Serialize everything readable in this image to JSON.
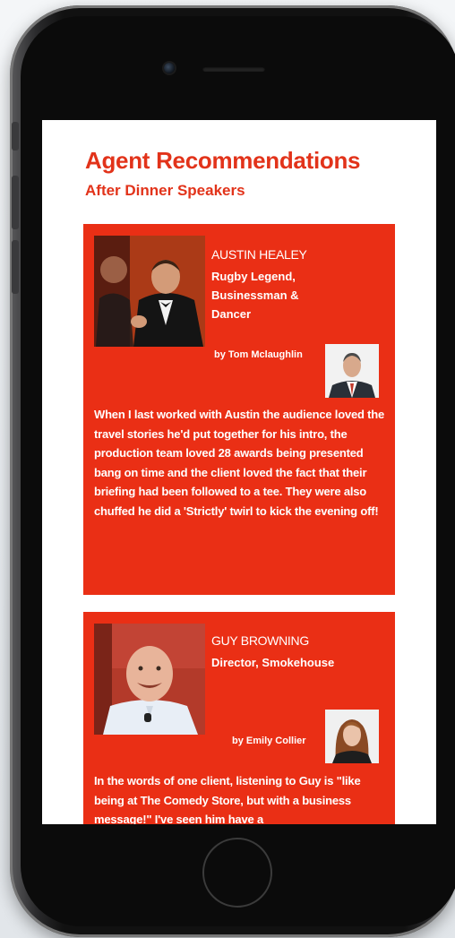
{
  "page": {
    "title": "Agent Recommendations",
    "subtitle": "After Dinner Speakers"
  },
  "recommendations": [
    {
      "name": "AUSTIN HEALEY",
      "role": "Rugby Legend, Businessman & Dancer",
      "by": "by Tom Mclaughlin",
      "quote": "When I last worked with Austin the audience loved the travel stories he'd put together for his intro, the production team loved 28 awards being presented bang on time and the client loved the fact that their briefing had been followed to a tee. They were also chuffed he did a 'Strictly' twirl to kick the evening off!",
      "speaker_photo": "speaker-photo-tuxedo",
      "agent_photo": "agent-photo-man"
    },
    {
      "name": "GUY BROWNING",
      "role": "Director, Smokehouse",
      "by": "by Emily Collier",
      "quote": "In the words of one client, listening to Guy is \"like being at The Comedy Store, but with a business message!\" I've seen him have a",
      "speaker_photo": "speaker-photo-bald-man",
      "agent_photo": "agent-photo-woman"
    }
  ],
  "colors": {
    "accent": "#e2331a",
    "card_background": "#ea2f15",
    "screen_background": "#ffffff"
  }
}
